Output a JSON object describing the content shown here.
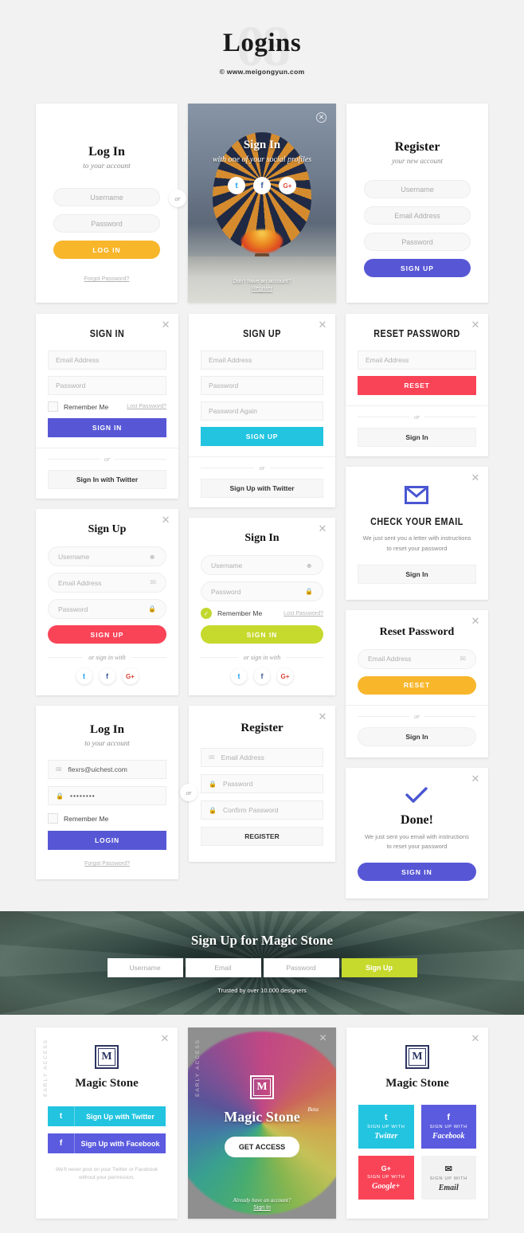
{
  "header": {
    "ghost": "08",
    "title": "Logins",
    "subtitle": "© www.meigongyun.com"
  },
  "colors": {
    "yellow": "#f8b62b",
    "indigo": "#5757d6",
    "blue_violet": "#5b5be0",
    "cyan": "#22c4e0",
    "red": "#f94458",
    "lime": "#c6d92d",
    "twitter": "#1da1f2",
    "facebook": "#4a56c2",
    "google": "#f94458",
    "navy": "#2d3561"
  },
  "icons": {
    "close": "✕",
    "close_circle": "✕",
    "twitter": "t",
    "facebook": "f",
    "google": "G+",
    "user": "☻",
    "mail": "✉",
    "lock": "🔒",
    "check": "✓"
  },
  "card_login_classic": {
    "title": "Log In",
    "subtitle": "to your account",
    "username_placeholder": "Username",
    "password_placeholder": "Password",
    "submit_label": "LOG IN",
    "forgot_label": "Forgot Password?"
  },
  "card_social_hero": {
    "title": "Sign In",
    "subtitle": "with one of your social profiles",
    "socials": [
      "twitter",
      "facebook",
      "google"
    ],
    "foot_text": "Don't have an account?",
    "foot_link": "Register",
    "or_badge": "or"
  },
  "card_register_classic": {
    "title": "Register",
    "subtitle": "your new account",
    "username_placeholder": "Username",
    "email_placeholder": "Email Address",
    "password_placeholder": "Password",
    "submit_label": "SIGN UP"
  },
  "card_signin_flat": {
    "title": "SIGN IN",
    "email_placeholder": "Email Address",
    "password_placeholder": "Password",
    "remember_label": "Remember Me",
    "lost_label": "Lost Password?",
    "submit_label": "SIGN IN",
    "divider": "or",
    "social_label": "Sign In with Twitter"
  },
  "card_signup_flat": {
    "title": "SIGN UP",
    "email_placeholder": "Email Address",
    "password_placeholder": "Password",
    "password_again_placeholder": "Password Again",
    "submit_label": "SIGN UP",
    "divider": "or",
    "social_label": "Sign Up with Twitter"
  },
  "card_reset_flat": {
    "title": "RESET PASSWORD",
    "email_placeholder": "Email Address",
    "submit_label": "RESET",
    "divider": "or",
    "secondary_label": "Sign In"
  },
  "card_check_email": {
    "title": "CHECK YOUR EMAIL",
    "body_line1": "We just sent you a letter with instructions",
    "body_line2": "to reset your password",
    "secondary_label": "Sign In"
  },
  "card_signup_round": {
    "title": "Sign Up",
    "username_placeholder": "Username",
    "email_placeholder": "Email Address",
    "password_placeholder": "Password",
    "submit_label": "SIGN UP",
    "divider": "or sign in with",
    "socials": [
      "twitter",
      "facebook",
      "google"
    ]
  },
  "card_signin_round": {
    "title": "Sign In",
    "username_placeholder": "Username",
    "password_placeholder": "Password",
    "remember_label": "Remember Me",
    "lost_label": "Lost Password?",
    "submit_label": "SIGN IN",
    "divider": "or sign in with",
    "socials": [
      "twitter",
      "facebook",
      "google"
    ]
  },
  "card_reset_round": {
    "title": "Reset Password",
    "email_placeholder": "Email Address",
    "submit_label": "RESET",
    "divider": "or",
    "secondary_label": "Sign In"
  },
  "card_done": {
    "title": "Done!",
    "body_line1": "We just sent you email with instructions",
    "body_line2": "to reset your password",
    "submit_label": "SIGN IN"
  },
  "card_login_filled": {
    "title": "Log In",
    "subtitle": "to your account",
    "email_value": "flexrs@uichest.com",
    "password_value": "••••••••",
    "remember_label": "Remember Me",
    "submit_label": "LOGIN",
    "forgot_label": "Forgot Password?",
    "or_badge": "or"
  },
  "card_register_filled": {
    "title": "Register",
    "email_placeholder": "Email Address",
    "password_placeholder": "Password",
    "confirm_placeholder": "Confirm Password",
    "submit_label": "REGISTER"
  },
  "banner": {
    "title": "Sign Up for Magic Stone",
    "username_placeholder": "Username",
    "email_placeholder": "Email",
    "password_placeholder": "Password",
    "submit_label": "Sign Up",
    "foot": "Trusted by over 10.000 designers"
  },
  "ms_social": {
    "early_access": "EARLY ACCESS",
    "logo_letter": "M",
    "brand": "Magic Stone",
    "twitter_label": "Sign Up with Twitter",
    "facebook_label": "Sign Up with Facebook",
    "note_line1": "We'll never post on your Twitter or Facebook",
    "note_line2": "without your permission."
  },
  "ms_photo": {
    "early_access": "EARLY ACCESS",
    "logo_letter": "M",
    "brand": "Magic Stone",
    "beta": "Beta",
    "cta_label": "GET ACCESS",
    "foot_text": "Already have an account?",
    "foot_link": "Sign In"
  },
  "ms_tiles": {
    "logo_letter": "M",
    "brand": "Magic Stone",
    "prefix": "SIGN UP WITH",
    "tiles": [
      {
        "network": "Twitter",
        "icon": "twitter",
        "color": "#22c4e0"
      },
      {
        "network": "Facebook",
        "icon": "facebook",
        "color": "#5b5be0"
      },
      {
        "network": "Google+",
        "icon": "google",
        "color": "#f94458"
      },
      {
        "network": "Email",
        "icon": "mail",
        "color": "#f2f2f2"
      }
    ]
  }
}
